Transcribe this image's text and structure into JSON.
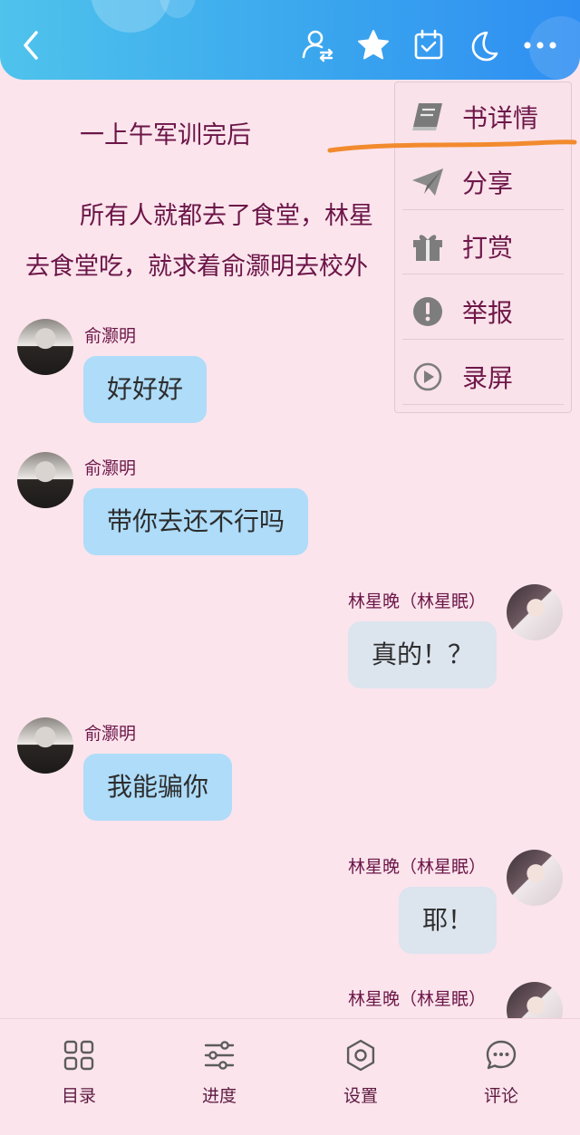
{
  "header": {
    "back_icon": "chevron-left-icon",
    "actions": [
      "user-switch-icon",
      "star-icon",
      "calendar-check-icon",
      "moon-icon",
      "more-icon"
    ]
  },
  "content": {
    "paragraph1": "一上午军训完后",
    "paragraph2_line1": "所有人就都去了食堂，林星",
    "paragraph2_line2": "去食堂吃，就求着俞灏明去校外"
  },
  "messages": [
    {
      "sender": "俞灏明",
      "text": "好好好"
    },
    {
      "sender": "俞灏明",
      "text": "带你去还不行吗"
    },
    {
      "sender": "林星晚（林星眠）",
      "text": "真的！？"
    },
    {
      "sender": "俞灏明",
      "text": "我能骗你"
    },
    {
      "sender": "林星晚（林星眠）",
      "text": "耶！"
    },
    {
      "sender": "林星晚（林星眠）",
      "text": ""
    }
  ],
  "menu": {
    "items": [
      {
        "label": "书详情",
        "icon": "book-icon"
      },
      {
        "label": "分享",
        "icon": "paper-plane-icon"
      },
      {
        "label": "打赏",
        "icon": "gift-icon"
      },
      {
        "label": "举报",
        "icon": "exclamation-circle-icon"
      },
      {
        "label": "录屏",
        "icon": "play-circle-icon"
      }
    ]
  },
  "bottom_nav": [
    {
      "label": "目录",
      "icon": "grid-icon"
    },
    {
      "label": "进度",
      "icon": "sliders-icon"
    },
    {
      "label": "设置",
      "icon": "gear-icon"
    },
    {
      "label": "评论",
      "icon": "chat-bubble-icon"
    }
  ],
  "colors": {
    "background": "#fbe4ec",
    "header_start": "#4fc3ec",
    "header_end": "#2f8ef2",
    "text": "#6e1748",
    "bubble_left": "#aedcf9",
    "bubble_right": "#dce4ee",
    "annotation": "#f28a2e"
  }
}
